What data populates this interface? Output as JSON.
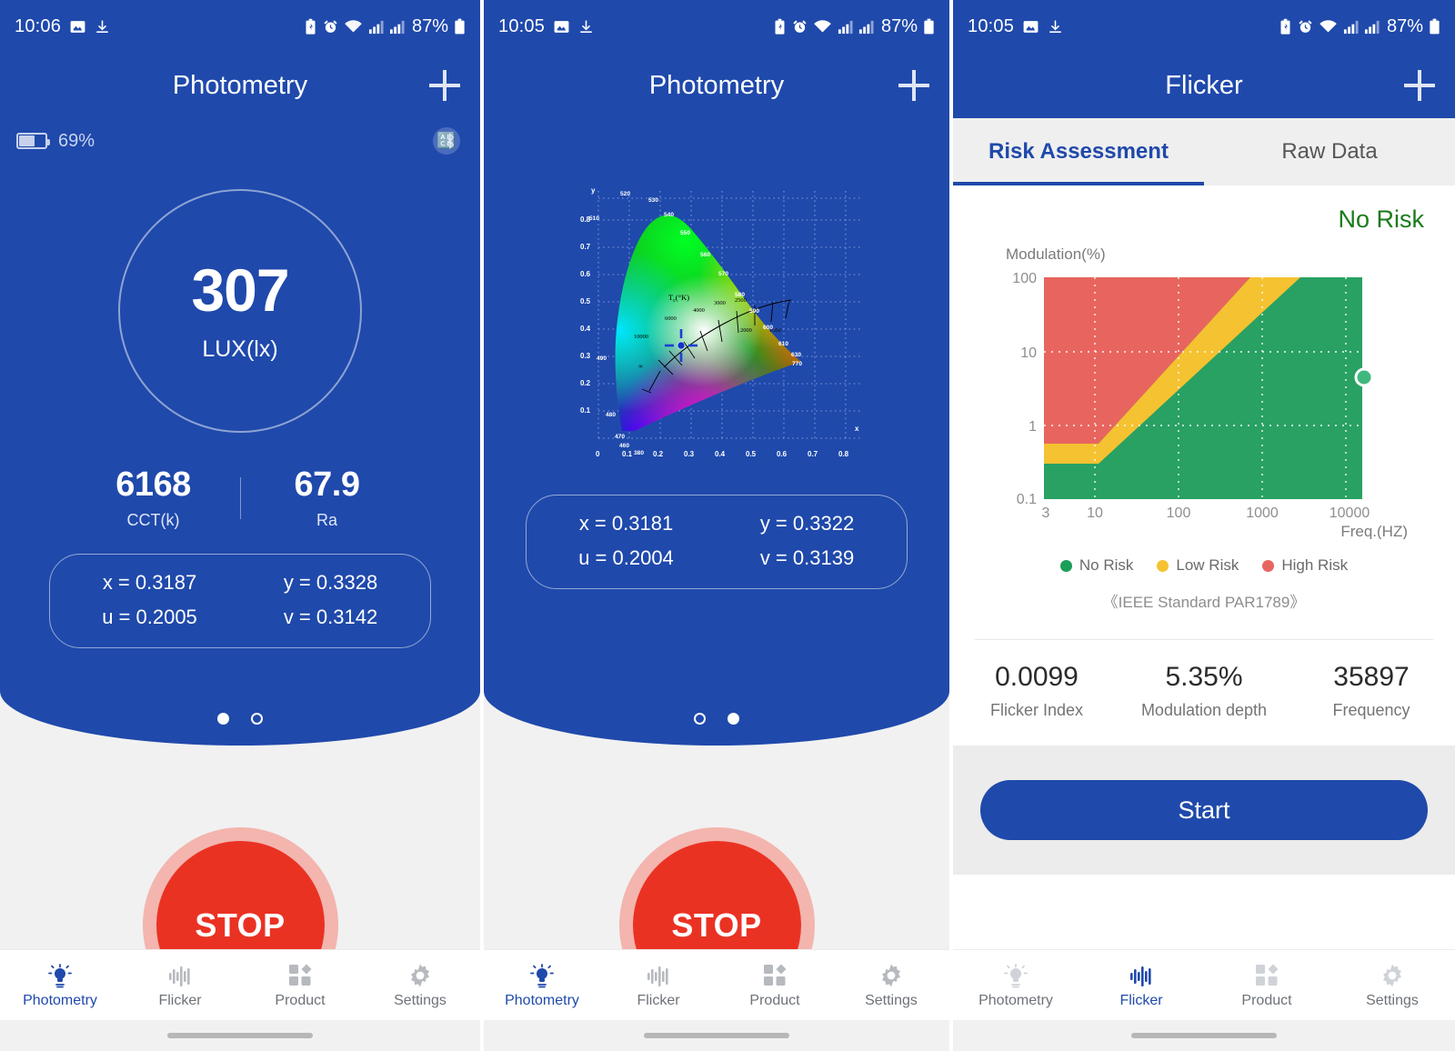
{
  "screens": [
    {
      "status": {
        "time": "10:06",
        "battery_pct": "87%",
        "icons": [
          "image-icon",
          "download-icon",
          "battery-saver-icon",
          "alarm-icon",
          "wifi-icon",
          "signal-1-icon",
          "signal-2-icon"
        ]
      },
      "appbar": {
        "title": "Photometry",
        "action": "+"
      },
      "device": {
        "battery_label": "69%",
        "bluetooth": "bluetooth-icon"
      },
      "lux": {
        "value": "307",
        "label": "LUX(lx)"
      },
      "metrics": [
        {
          "value": "6168",
          "label": "CCT(k)"
        },
        {
          "value": "67.9",
          "label": "Ra"
        }
      ],
      "coords": [
        {
          "left": "x = 0.3187",
          "right": "y = 0.3328"
        },
        {
          "left": "u = 0.2005",
          "right": "v = 0.3142"
        }
      ],
      "pager": {
        "count": 2,
        "active": 0
      },
      "action_button": "STOP"
    },
    {
      "status": {
        "time": "10:05",
        "battery_pct": "87%"
      },
      "appbar": {
        "title": "Photometry",
        "action": "+"
      },
      "coords": [
        {
          "left": "x = 0.3181",
          "right": "y = 0.3322"
        },
        {
          "left": "u = 0.2004",
          "right": "v = 0.3139"
        }
      ],
      "pager": {
        "count": 2,
        "active": 1
      },
      "action_button": "STOP"
    },
    {
      "status": {
        "time": "10:05",
        "battery_pct": "87%"
      },
      "appbar": {
        "title": "Flicker",
        "action": "+"
      },
      "tabs": [
        {
          "label": "Risk Assessment",
          "active": true
        },
        {
          "label": "Raw Data",
          "active": false
        }
      ],
      "risk_status": "No Risk",
      "standard_note": "《IEEE Standard PAR1789》",
      "stats": [
        {
          "value": "0.0099",
          "label": "Flicker Index"
        },
        {
          "value": "5.35%",
          "label": "Modulation depth"
        },
        {
          "value": "35897",
          "label": "Frequency"
        }
      ],
      "action_button": "Start"
    }
  ],
  "nav": {
    "items": [
      {
        "label": "Photometry",
        "icon": "lightbulb-icon"
      },
      {
        "label": "Flicker",
        "icon": "waveform-icon"
      },
      {
        "label": "Product",
        "icon": "grid-icon"
      },
      {
        "label": "Settings",
        "icon": "gear-icon"
      }
    ]
  },
  "colors": {
    "brand_blue": "#1f49ab",
    "stop_red": "#ea3223",
    "no_risk_green": "#1a7a1a",
    "low_risk_yellow": "#f5c231",
    "high_risk_red": "#e8655f",
    "zone_green": "#28a163"
  },
  "chart_data": [
    {
      "type": "scatter",
      "name": "cie-1931-chromaticity-diagram",
      "title": "",
      "xlabel": "x",
      "ylabel": "y",
      "xlim": [
        0,
        0.85
      ],
      "ylim": [
        0,
        0.9
      ],
      "xticks": [
        "0",
        "0.1",
        "0.2",
        "0.3",
        "0.4",
        "0.5",
        "0.6",
        "0.7",
        "0.8"
      ],
      "yticks": [
        "0.1",
        "0.2",
        "0.3",
        "0.4",
        "0.5",
        "0.6",
        "0.7",
        "0.8"
      ],
      "wavelength_labels": [
        "380",
        "460",
        "470",
        "480",
        "490",
        "510",
        "520",
        "530",
        "540",
        "550",
        "560",
        "570",
        "580",
        "590",
        "600",
        "610",
        "630",
        "770"
      ],
      "locus_label": "Tc(°K)",
      "locus_temperatures": [
        "10000",
        "6000",
        "4000",
        "3000",
        "2500",
        "2000",
        "1500",
        "∞"
      ],
      "points": [
        {
          "x": 0.3181,
          "y": 0.3322,
          "marker": "crosshair"
        }
      ],
      "grid": true,
      "legend": "none"
    },
    {
      "type": "area",
      "name": "flicker-risk-chart",
      "title": "Modulation(%)",
      "xlabel": "Freq.(HZ)",
      "ylabel": "Modulation(%)",
      "xscale": "log",
      "yscale": "log",
      "xlim": [
        3,
        10000
      ],
      "ylim": [
        0.1,
        100
      ],
      "xticks": [
        "3",
        "10",
        "100",
        "1000",
        "10000"
      ],
      "yticks": [
        "0.1",
        "1",
        "10",
        "100"
      ],
      "grid": true,
      "legend_position": "bottom",
      "series": [
        {
          "name": "No Risk",
          "color": "#28a163",
          "values": []
        },
        {
          "name": "Low Risk",
          "color": "#f5c231",
          "values": []
        },
        {
          "name": "High Risk",
          "color": "#e8655f",
          "values": []
        }
      ],
      "boundaries": {
        "low_risk_lower": [
          [
            3,
            0.3
          ],
          [
            10,
            0.3
          ],
          [
            10000,
            250
          ]
        ],
        "high_risk_lower": [
          [
            3,
            0.8
          ],
          [
            10,
            0.8
          ],
          [
            10000,
            800
          ]
        ]
      },
      "points": [
        {
          "x": 35897,
          "y": 5.35,
          "zone": "No Risk",
          "label": "measurement"
        }
      ],
      "annotation": "《IEEE Standard PAR1789》"
    }
  ]
}
